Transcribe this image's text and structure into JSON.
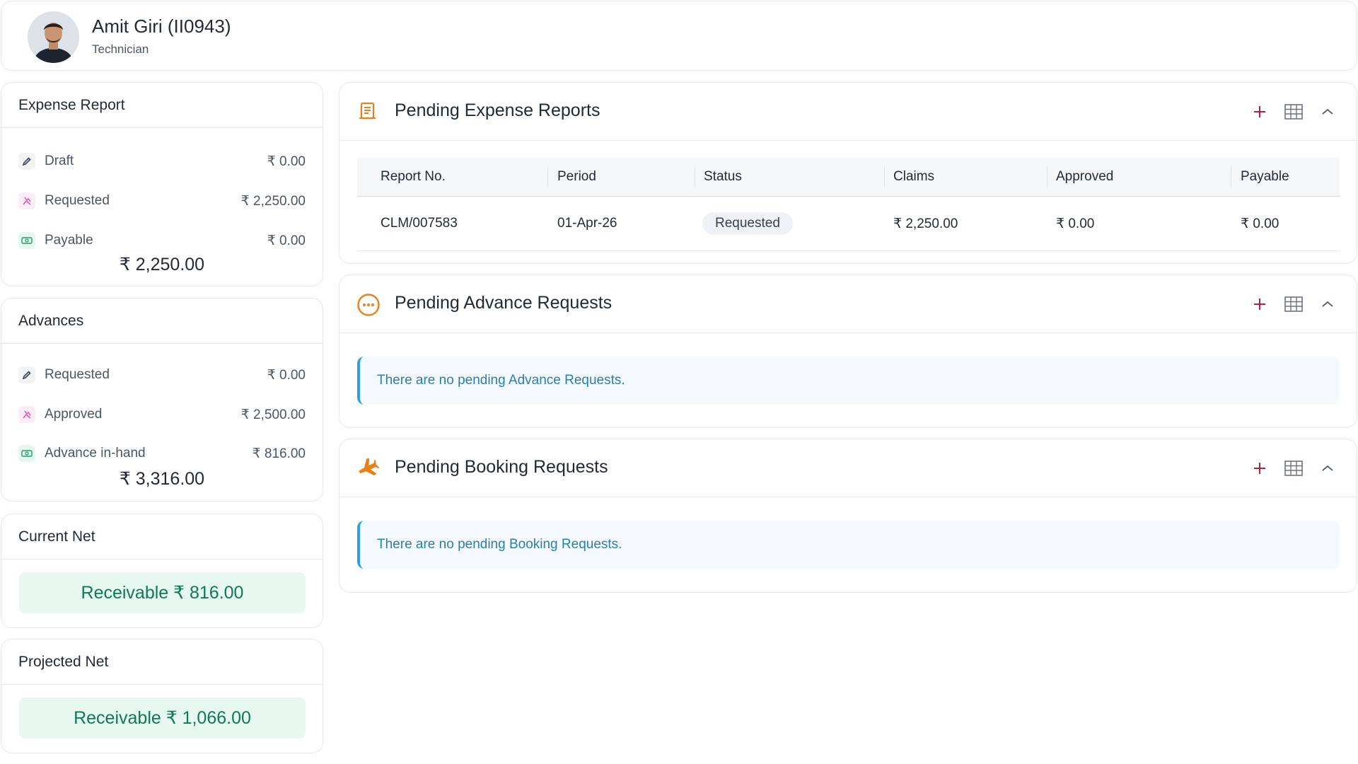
{
  "profile": {
    "name": "Amit Giri (II0943)",
    "role": "Technician"
  },
  "expense_report": {
    "title": "Expense Report",
    "rows": [
      {
        "label": "Draft",
        "value": "₹ 0.00",
        "icon": "pencil-icon"
      },
      {
        "label": "Requested",
        "value": "₹ 2,250.00",
        "icon": "hand-icon"
      },
      {
        "label": "Payable",
        "value": "₹ 0.00",
        "icon": "cash-icon"
      }
    ],
    "total": "₹ 2,250.00"
  },
  "advances": {
    "title": "Advances",
    "rows": [
      {
        "label": "Requested",
        "value": "₹ 0.00",
        "icon": "pencil-icon"
      },
      {
        "label": "Approved",
        "value": "₹ 2,500.00",
        "icon": "hand-icon"
      },
      {
        "label": "Advance in-hand",
        "value": "₹ 816.00",
        "icon": "cash-icon"
      }
    ],
    "total": "₹ 3,316.00"
  },
  "current_net": {
    "title": "Current Net",
    "value": "Receivable ₹ 816.00"
  },
  "projected_net": {
    "title": "Projected Net",
    "value": "Receivable ₹ 1,066.00"
  },
  "pending_expense": {
    "title": "Pending Expense Reports",
    "columns": [
      "Report No.",
      "Period",
      "Status",
      "Claims",
      "Approved",
      "Payable"
    ],
    "rows": [
      {
        "report_no": "CLM/007583",
        "period": "01-Apr-26",
        "status": "Requested",
        "claims": "₹ 2,250.00",
        "approved": "₹ 0.00",
        "payable": "₹ 0.00"
      }
    ]
  },
  "pending_advance": {
    "title": "Pending Advance Requests",
    "empty_message": "There are no pending Advance Requests."
  },
  "pending_booking": {
    "title": "Pending Booking Requests",
    "empty_message": "There are no pending Booking Requests."
  },
  "colors": {
    "accent_plus": "#b0213e",
    "net_bg": "#e7f8f1",
    "net_text": "#0f7a4f",
    "info_border": "#2aa0dc",
    "info_text": "#2b7fae",
    "icon_orange": "#e8811a"
  },
  "icons": {
    "add": "plus-icon",
    "grid": "table-grid-icon",
    "collapse": "chevron-up-icon"
  }
}
